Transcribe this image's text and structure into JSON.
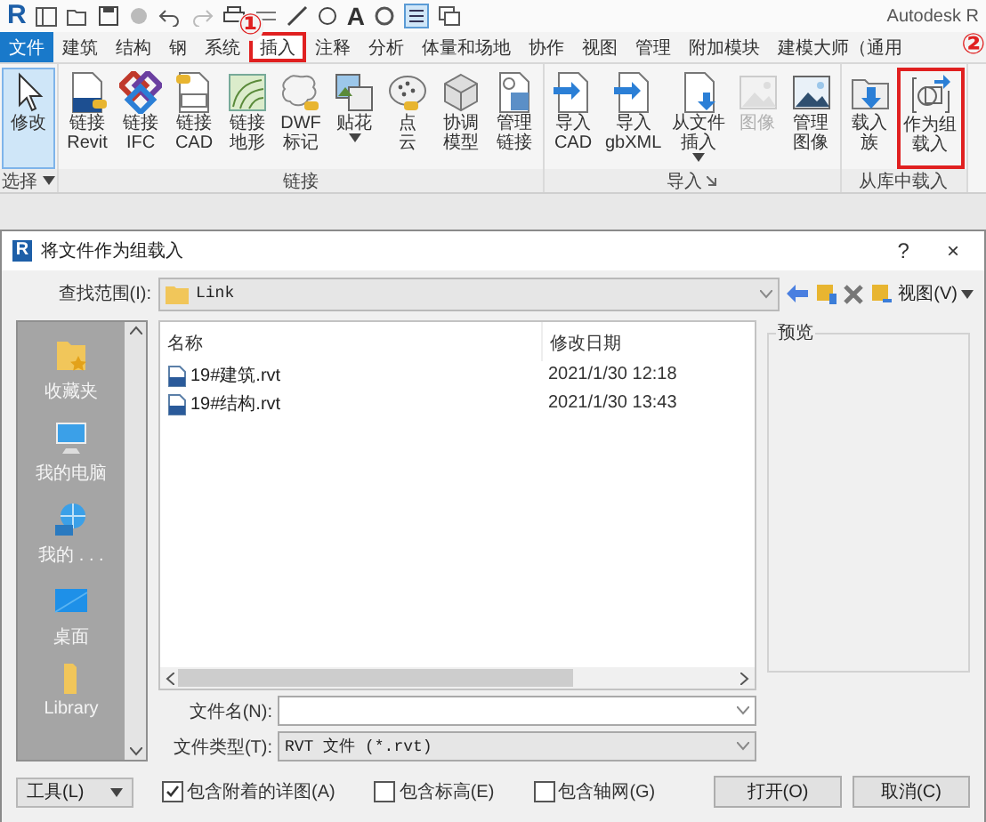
{
  "app": {
    "logo": "R",
    "text_tool": "A",
    "title": "Autodesk R"
  },
  "tabs": [
    {
      "label": "文件",
      "kind": "file",
      "selected": false,
      "highlighted": false
    },
    {
      "label": "建筑",
      "kind": "tab",
      "selected": false,
      "highlighted": false
    },
    {
      "label": "结构",
      "kind": "tab",
      "selected": false,
      "highlighted": false
    },
    {
      "label": "钢",
      "kind": "tab",
      "selected": false,
      "highlighted": false
    },
    {
      "label": "系统",
      "kind": "tab",
      "selected": false,
      "highlighted": false
    },
    {
      "label": "插入",
      "kind": "tab",
      "selected": true,
      "highlighted": true,
      "marker": "①"
    },
    {
      "label": "注释",
      "kind": "tab",
      "selected": false,
      "highlighted": false
    },
    {
      "label": "分析",
      "kind": "tab",
      "selected": false,
      "highlighted": false
    },
    {
      "label": "体量和场地",
      "kind": "tab",
      "selected": false,
      "highlighted": false
    },
    {
      "label": "协作",
      "kind": "tab",
      "selected": false,
      "highlighted": false
    },
    {
      "label": "视图",
      "kind": "tab",
      "selected": false,
      "highlighted": false
    },
    {
      "label": "管理",
      "kind": "tab",
      "selected": false,
      "highlighted": false
    },
    {
      "label": "附加模块",
      "kind": "tab",
      "selected": false,
      "highlighted": false
    },
    {
      "label": "建模大师（通用",
      "kind": "tab",
      "selected": false,
      "highlighted": false
    }
  ],
  "ribbon": {
    "groups": [
      {
        "label": "选择",
        "dropdown": true,
        "launcher": false,
        "buttons": [
          {
            "lines": [
              "修改"
            ],
            "kind": "cursor",
            "selected": true,
            "disabled": false,
            "dropdown": false,
            "highlighted": false
          }
        ]
      },
      {
        "label": "链接",
        "dropdown": false,
        "launcher": false,
        "buttons": [
          {
            "lines": [
              "链接",
              "Revit"
            ],
            "kind": "revit",
            "selected": false,
            "disabled": false,
            "dropdown": false,
            "highlighted": false
          },
          {
            "lines": [
              "链接",
              "IFC"
            ],
            "kind": "ifc",
            "selected": false,
            "disabled": false,
            "dropdown": false,
            "highlighted": false
          },
          {
            "lines": [
              "链接",
              "CAD"
            ],
            "kind": "cad",
            "selected": false,
            "disabled": false,
            "dropdown": false,
            "highlighted": false
          },
          {
            "lines": [
              "链接",
              "地形"
            ],
            "kind": "topo",
            "selected": false,
            "disabled": false,
            "dropdown": false,
            "highlighted": false
          },
          {
            "lines": [
              "DWF",
              "标记"
            ],
            "kind": "dwf",
            "selected": false,
            "disabled": false,
            "dropdown": false,
            "highlighted": false
          },
          {
            "lines": [
              "贴花"
            ],
            "kind": "decal",
            "selected": false,
            "disabled": false,
            "dropdown": true,
            "highlighted": false
          },
          {
            "lines": [
              "点",
              "云"
            ],
            "kind": "pointcloud",
            "selected": false,
            "disabled": false,
            "dropdown": false,
            "highlighted": false
          },
          {
            "lines": [
              "协调",
              "模型"
            ],
            "kind": "coordination",
            "selected": false,
            "disabled": false,
            "dropdown": false,
            "highlighted": false
          },
          {
            "lines": [
              "管理",
              "链接"
            ],
            "kind": "manage",
            "selected": false,
            "disabled": false,
            "dropdown": false,
            "highlighted": false
          }
        ]
      },
      {
        "label": "导入",
        "dropdown": false,
        "launcher": true,
        "buttons": [
          {
            "lines": [
              "导入",
              "CAD"
            ],
            "kind": "import",
            "selected": false,
            "disabled": false,
            "dropdown": false,
            "highlighted": false
          },
          {
            "lines": [
              "导入",
              "gbXML"
            ],
            "kind": "import",
            "selected": false,
            "disabled": false,
            "dropdown": false,
            "highlighted": false
          },
          {
            "lines": [
              "从文件",
              "插入"
            ],
            "kind": "insert",
            "selected": false,
            "disabled": false,
            "dropdown": true,
            "highlighted": false
          },
          {
            "lines": [
              "图像"
            ],
            "kind": "image",
            "selected": false,
            "disabled": true,
            "dropdown": false,
            "highlighted": false
          },
          {
            "lines": [
              "管理",
              "图像"
            ],
            "kind": "image",
            "selected": false,
            "disabled": false,
            "dropdown": false,
            "highlighted": false
          }
        ]
      },
      {
        "label": "从库中载入",
        "dropdown": false,
        "launcher": false,
        "buttons": [
          {
            "lines": [
              "载入",
              "族"
            ],
            "kind": "family",
            "selected": false,
            "disabled": false,
            "dropdown": false,
            "highlighted": false
          },
          {
            "lines": [
              "作为组",
              "载入"
            ],
            "kind": "group",
            "selected": false,
            "disabled": false,
            "dropdown": false,
            "highlighted": true,
            "marker": "②"
          }
        ]
      }
    ]
  },
  "dialog": {
    "logo": "R",
    "title": "将文件作为组载入",
    "help": "?",
    "close": "×",
    "look_in": {
      "label": "查找范围(I):",
      "value": "Link"
    },
    "view_menu": "视图(V)",
    "places": [
      {
        "label": "收藏夹",
        "kind": "favorites"
      },
      {
        "label": "我的电脑",
        "kind": "computer"
      },
      {
        "label": "我的 . . .",
        "kind": "network"
      },
      {
        "label": "桌面",
        "kind": "desktop"
      },
      {
        "label": "Library",
        "kind": "folder"
      }
    ],
    "columns": [
      "名称",
      "修改日期"
    ],
    "files": [
      {
        "name": "19#建筑.rvt",
        "modified": "2021/1/30 12:18"
      },
      {
        "name": "19#结构.rvt",
        "modified": "2021/1/30 13:43"
      }
    ],
    "preview_label": "预览",
    "file_name": {
      "label": "文件名(N):"
    },
    "file_type": {
      "label": "文件类型(T):",
      "value": "RVT 文件 (*.rvt)"
    },
    "tools": "工具(L)",
    "options": [
      {
        "label": "包含附着的详图(A)",
        "checked": true
      },
      {
        "label": "包含标高(E)",
        "checked": false
      },
      {
        "label": "包含轴网(G)",
        "checked": false
      }
    ],
    "buttons": [
      "打开(O)",
      "取消(C)"
    ]
  }
}
